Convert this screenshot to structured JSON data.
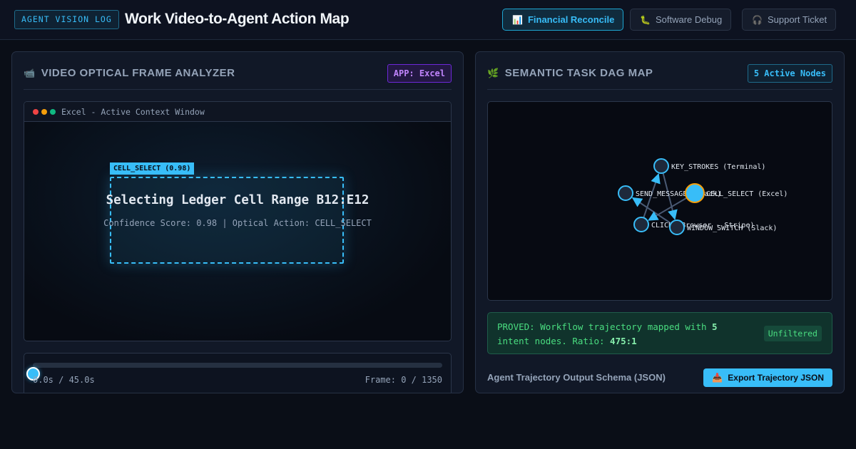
{
  "header": {
    "brand_badge": "AGENT VISION LOG",
    "title": "Work Video-to-Agent Action Map",
    "scenario_tabs": [
      {
        "label": "Financial Reconcile",
        "icon": "bar-chart-icon",
        "active": true
      },
      {
        "label": "Software Debug",
        "icon": "bug-icon",
        "active": false
      },
      {
        "label": "Support Ticket",
        "icon": "headphones-icon",
        "active": false
      }
    ]
  },
  "left_panel": {
    "icon": "video-camera-icon",
    "title": "VIDEO OPTICAL FRAME ANALYZER",
    "app_tag": "APP: Excel",
    "window": {
      "title": "Excel - Active Context Window",
      "controls": [
        "#ef4444",
        "#f59e0b",
        "#10b981"
      ]
    },
    "detection": {
      "label": "CELL_SELECT (0.98)",
      "action_text": "Selecting Ledger Cell Range B12:E12",
      "detail_text": "Confidence Score: 0.98 | Optical Action: CELL_SELECT"
    },
    "timeline": {
      "progress": 0,
      "time_readout": "0.0s / 45.0s",
      "frame_readout": "Frame: 0 / 1350"
    }
  },
  "right_panel": {
    "icon": "leaf-icon",
    "title": "SEMANTIC TASK DAG MAP",
    "nodes_tag": "5 Active Nodes",
    "graph": {
      "nodes": [
        {
          "id": "key",
          "label": "KEY_STROKES (Terminal)",
          "active": false
        },
        {
          "id": "send",
          "label": "SEND_MESSAGE (Slack)",
          "active": false
        },
        {
          "id": "cell",
          "label": "CELL_SELECT (Excel)",
          "active": true
        },
        {
          "id": "click",
          "label": "CLICK (Browser - Stripe)",
          "active": false
        },
        {
          "id": "window",
          "label": "WINDOW_SWITCH (Slack)",
          "active": false
        }
      ],
      "edges": [
        {
          "from": "key",
          "to": "window"
        },
        {
          "from": "click",
          "to": "key"
        },
        {
          "from": "window",
          "to": "send"
        },
        {
          "from": "cell",
          "to": "click"
        }
      ]
    },
    "proof": {
      "prefix": "PROVED: Workflow trajectory mapped with ",
      "node_count": "5",
      "middle": " intent nodes. Ratio: ",
      "ratio": "475:1",
      "badge": "Unfiltered"
    },
    "schema_label": "Agent Trajectory Output Schema (JSON)",
    "export_button": {
      "label": "Export Trajectory JSON",
      "icon": "download-tray-icon"
    }
  },
  "colors": {
    "accent": "#38bdf8",
    "success": "#4ade80",
    "purple": "#c084fc",
    "active_node": "#38bdf8",
    "active_node_ring": "#f59e0b"
  }
}
